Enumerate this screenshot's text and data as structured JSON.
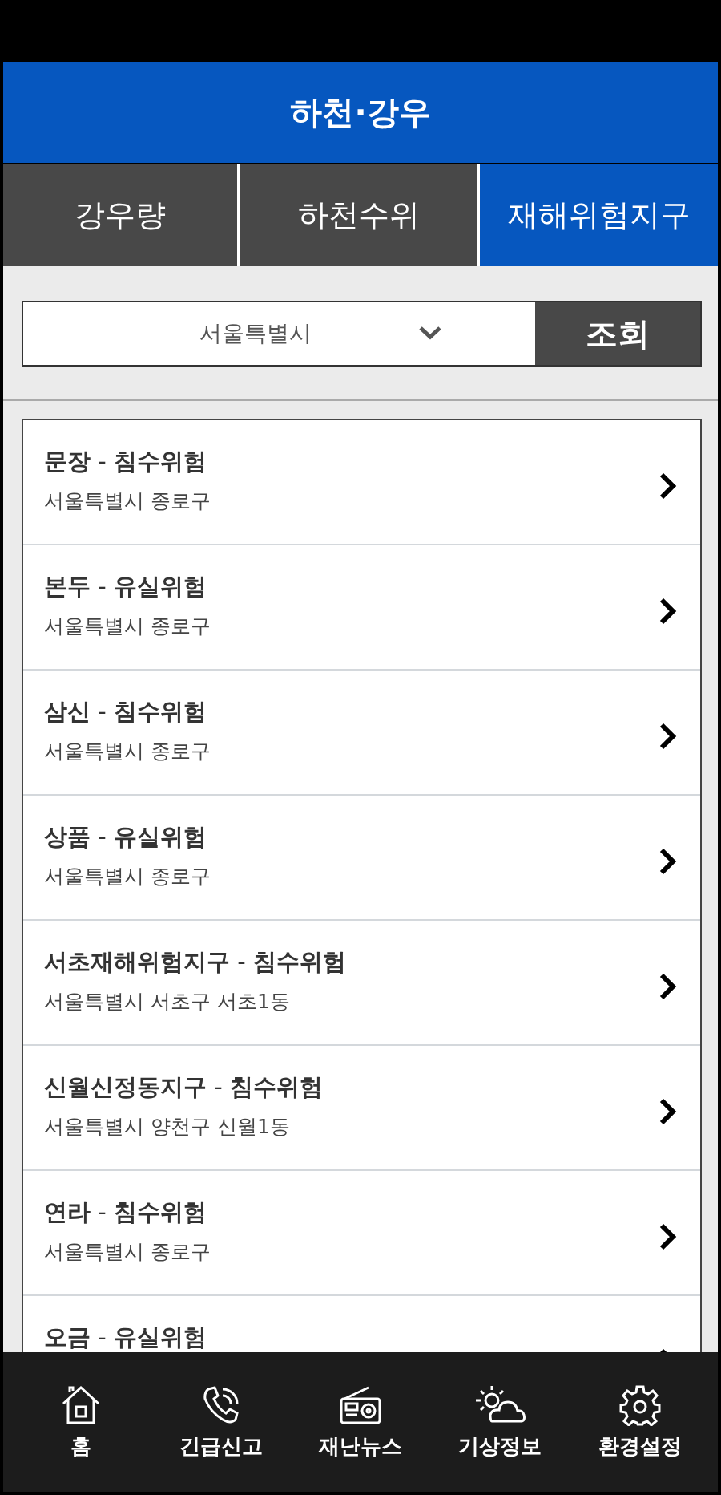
{
  "header": {
    "title": "하천·강우"
  },
  "tabs": [
    {
      "label": "강우량",
      "selected": false
    },
    {
      "label": "하천수위",
      "selected": false
    },
    {
      "label": "재해위험지구",
      "selected": true
    }
  ],
  "filter": {
    "region": "서울특별시",
    "button": "조회"
  },
  "districts": [
    {
      "title": "**문장** - **침수위험**",
      "address": "서울특별시 종로구"
    },
    {
      "title": "**본두** - **유실위험**",
      "address": "서울특별시 종로구"
    },
    {
      "title": "**삼신** - **침수위험**",
      "address": "서울특별시 종로구"
    },
    {
      "title": "**상품** - **유실위험**",
      "address": "서울특별시 종로구"
    },
    {
      "title": "**서초재해위험지구** - **침수위험**",
      "address": "서울특별시 서초구 서초1동"
    },
    {
      "title": "**신월신정동지구** - **침수위험**",
      "address": "서울특별시 양천구 신월1동"
    },
    {
      "title": "**연라** - **침수위험**",
      "address": "서울특별시 종로구"
    },
    {
      "title": "**오금** - **유실위험**"
    }
  ],
  "nav": [
    {
      "kind": "home",
      "label": "홈"
    },
    {
      "kind": "phone",
      "label": "긴급신고"
    },
    {
      "kind": "radio",
      "label": "재난뉴스"
    },
    {
      "kind": "weather",
      "label": "기상정보"
    },
    {
      "kind": "settings",
      "label": "환경설정"
    }
  ]
}
